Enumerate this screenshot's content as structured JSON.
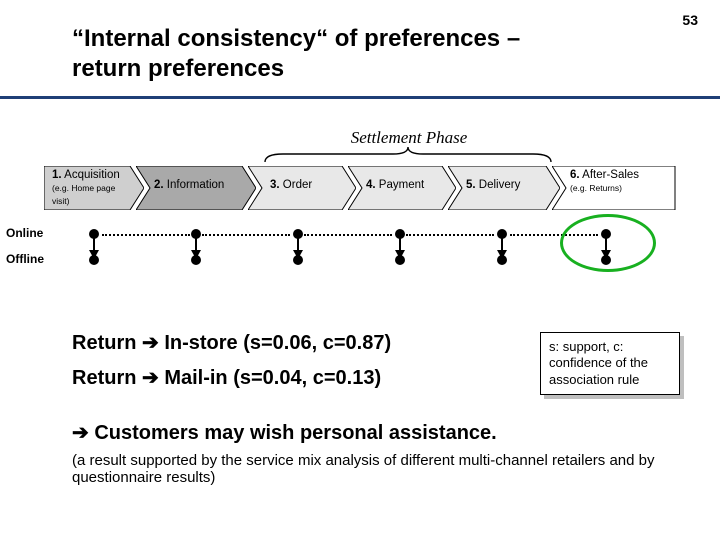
{
  "page_number": "53",
  "title_line1": "“Internal consistency“ of preferences –",
  "title_line2": "return preferences",
  "settlement_label": "Settlement Phase",
  "phases": [
    {
      "num": "1.",
      "name": "Acquisition",
      "sub": "(e.g. Home page visit)",
      "fill": "#cfcfcf"
    },
    {
      "num": "2.",
      "name": "Information",
      "sub": "",
      "fill": "#a9a9a9"
    },
    {
      "num": "3.",
      "name": "Order",
      "sub": "",
      "fill": "#e8e8e8"
    },
    {
      "num": "4.",
      "name": "Payment",
      "sub": "",
      "fill": "#e8e8e8"
    },
    {
      "num": "5.",
      "name": "Delivery",
      "sub": "",
      "fill": "#e8e8e8"
    },
    {
      "num": "6.",
      "name": "After-Sales",
      "sub": "(e.g. Returns)",
      "fill": "#ffffff"
    }
  ],
  "channels": {
    "online": "Online",
    "offline": "Offline"
  },
  "bullets": {
    "b1_pre": "Return ",
    "b1_post": " In-store (s=0.06, c=0.87)",
    "b2_pre": "Return ",
    "b2_post": " Mail-in (s=0.04, c=0.13)"
  },
  "legend_text": "s: support, c: confidence of the association rule",
  "conclusion": " Customers may wish personal assistance.",
  "support_text": "(a result supported by the service mix analysis of different multi-channel retailers and by questionnaire results)",
  "arrow_glyph": "➔"
}
